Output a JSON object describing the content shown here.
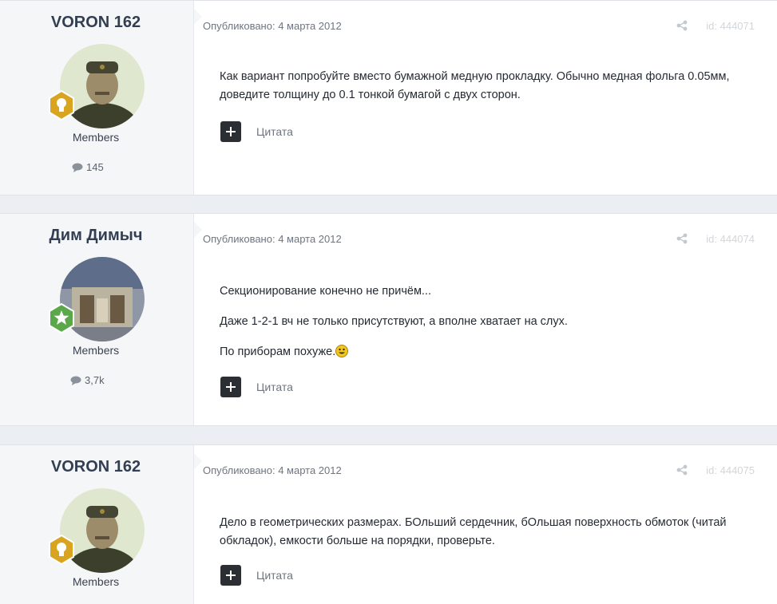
{
  "posts": [
    {
      "author": "VORON 162",
      "group": "Members",
      "post_count": "145",
      "rank_icon": "lightbulb-badge-icon",
      "rank_color": "#d9a520",
      "published_label": "Опубликовано: 4 марта 2012",
      "post_id": "id: 444071",
      "paragraphs": [
        "Как вариант попробуйте вместо бумажной медную прокладку. Обычно медная фольга 0.05мм, доведите толщину до 0.1 тонкой бумагой с двух сторон."
      ],
      "quote_label": "Цитата"
    },
    {
      "author": "Дим Димыч",
      "group": "Members",
      "post_count": "3,7k",
      "rank_icon": "star-badge-icon",
      "rank_color": "#5aa84a",
      "published_label": "Опубликовано: 4 марта 2012",
      "post_id": "id: 444074",
      "paragraphs": [
        "Секционирование конечно не причём...",
        "Даже 1-2-1 вч не только присутствуют, а вполне хватает на слух.",
        "По приборам похуже."
      ],
      "quote_label": "Цитата"
    },
    {
      "author": "VORON 162",
      "group": "Members",
      "post_count": "",
      "rank_icon": "lightbulb-badge-icon",
      "rank_color": "#d9a520",
      "published_label": "Опубликовано: 4 марта 2012",
      "post_id": "id: 444075",
      "paragraphs": [
        "Дело в геометрических размерах. БОльший сердечник, бОльшая поверхность обмоток (читай обкладок), емкости больше на порядки, проверьте."
      ],
      "quote_label": "Цитата"
    }
  ]
}
